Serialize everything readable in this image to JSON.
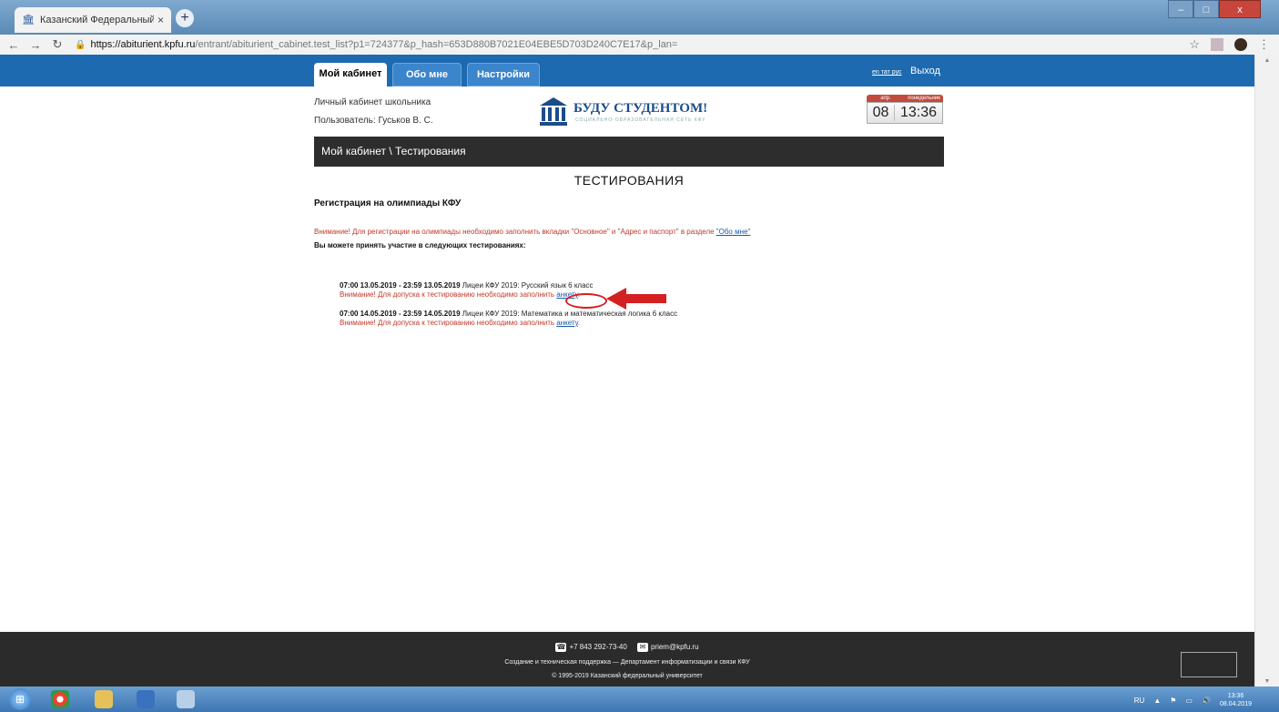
{
  "browser": {
    "tab_title": "Казанский Федеральный Униве",
    "url_host": "https://abiturient.kpfu.ru",
    "url_path": "/entrant/abiturient_cabinet.test_list?p1=724377&p_hash=653D880B7021E04EBE5D703D240C7E17&p_lan="
  },
  "nav": {
    "tabs": [
      "Мой кабинет",
      "Обо мне",
      "Настройки"
    ],
    "langs": "en тат рус",
    "logout": "Выход"
  },
  "header": {
    "cabinet": "Личный кабинет школьника",
    "user": "Пользователь: Гуськов В. С.",
    "logo_text": "БУДУ СТУДЕНТОМ!",
    "logo_sub": "СОЦИАЛЬНО-ОБРАЗОВАТЕЛЬНАЯ СЕТЬ КФУ",
    "date_month": "апр.",
    "date_weekday": "понедельник",
    "date_day": "08",
    "date_time": "13:36"
  },
  "breadcrumb": "Мой кабинет \\ Тестирования",
  "page_title": "ТЕСТИРОВАНИЯ",
  "section_title": "Регистрация на олимпиады КФУ",
  "warning": {
    "text": "Внимание! Для регистрации на олимпиады необходимо заполнить вкладки \"Основное\" и \"Адрес и паспорт\" в разделе ",
    "link": "\"Обо мне\""
  },
  "subtitle": "Вы можете принять участие в следующих тестированиях:",
  "tests": [
    {
      "dates": "07:00 13.05.2019 - 23:59 13.05.2019",
      "name": " Лицеи КФУ 2019: Русский язык 6 класс",
      "note": "Внимание! Для допуска к тестированию необходимо заполнить ",
      "link": "анкету",
      "tail": "."
    },
    {
      "dates": "07:00 14.05.2019 - 23:59 14.05.2019",
      "name": " Лицеи КФУ 2019: Математика и математическая логика 6 класс",
      "note": "Внимание! Для допуска к тестированию необходимо заполнить ",
      "link": "анкету",
      "tail": "."
    }
  ],
  "footer": {
    "phone": "+7 843 292-73-40",
    "email": "priem@kpfu.ru",
    "support": "Создание и техническая поддержка — Департамент информатизации и связи КФУ",
    "copyright": "© 1995-2019 Казанский федеральный университет"
  },
  "taskbar": {
    "lang": "RU",
    "time": "13:36",
    "date": "08.04.2019"
  },
  "colors": {
    "nav_blue": "#1e6ab0",
    "warning_red": "#c0392b",
    "link_blue": "#1a5aa8",
    "annotation_red": "#d42020"
  }
}
